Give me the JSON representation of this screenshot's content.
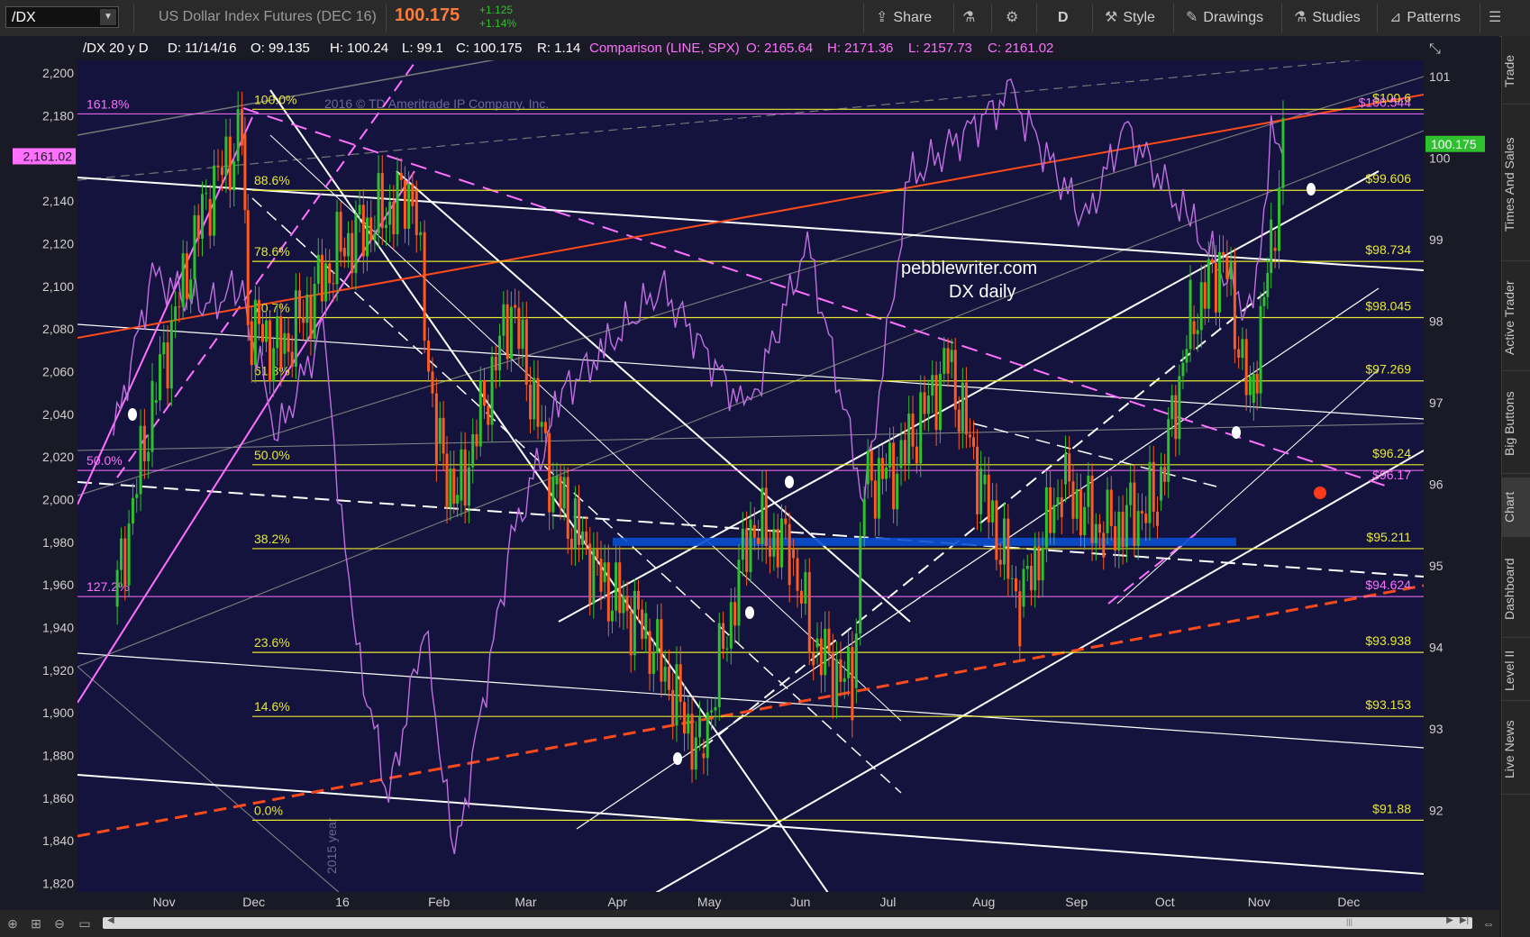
{
  "toolbar": {
    "symbol": "/DX",
    "description": "US Dollar Index Futures (DEC 16)",
    "last_price": "100.175",
    "change_abs": "+1.125",
    "change_pct": "+1.14%",
    "buttons": {
      "share": "Share",
      "timeframe": "D",
      "style": "Style",
      "drawings": "Drawings",
      "studies": "Studies",
      "patterns": "Patterns"
    }
  },
  "sidebar": {
    "tabs": [
      "Trade",
      "Times And Sales",
      "Active Trader",
      "Big Buttons",
      "Chart",
      "Dashboard",
      "Level II",
      "Live News"
    ],
    "active": "Chart"
  },
  "header": {
    "symbol": "/DX 20 y D",
    "date": "D: 11/14/16",
    "open": "O: 99.135",
    "high": "H: 100.24",
    "low": "L: 99.1",
    "close": "C: 100.175",
    "range": "R: 1.14",
    "comparison": "Comparison (LINE, SPX)",
    "cmp_open": "O: 2165.64",
    "cmp_high": "H: 2171.36",
    "cmp_low": "L: 2157.73",
    "cmp_close": "C: 2161.02"
  },
  "watermark": "2016 © TD Ameritrade IP Company, Inc.",
  "year_marker": "2015 year",
  "annotation": {
    "line1": "pebblewriter.com",
    "line2": "DX daily"
  },
  "colors": {
    "background": "#13133e",
    "up_candle": "#2ec02e",
    "down_candle": "#ff5a1e",
    "comparison_line": "#c070e0",
    "fib_line": "#e8e830",
    "magenta_line": "#ff70ff",
    "red_line": "#ff4a1a",
    "zone_blue": "#0a4fd0"
  },
  "chart_data": {
    "type": "candlestick",
    "x_labels": [
      "Nov",
      "Dec",
      "16",
      "Feb",
      "Mar",
      "Apr",
      "May",
      "Jun",
      "Jul",
      "Aug",
      "Sep",
      "Oct",
      "Nov",
      "Dec"
    ],
    "left_axis": {
      "label": "SPX",
      "ticks": [
        "2,200",
        "2,180",
        "2,160",
        "2,140",
        "2,120",
        "2,100",
        "2,080",
        "2,060",
        "2,040",
        "2,020",
        "2,000",
        "1,980",
        "1,960",
        "1,940",
        "1,920",
        "1,900",
        "1,880",
        "1,860",
        "1,840",
        "1,820"
      ],
      "range": [
        1816,
        2206
      ],
      "current_tag": "2,161.02"
    },
    "right_axis": {
      "label": "DX",
      "ticks": [
        "101",
        "100",
        "99",
        "98",
        "97",
        "96",
        "95",
        "94",
        "93",
        "92"
      ],
      "range": [
        91.0,
        101.2
      ],
      "current_tag": "100.175"
    },
    "fib_levels": [
      {
        "pct": "100.0%",
        "value": "$100.6",
        "dx": 100.6
      },
      {
        "pct": "88.6%",
        "value": "$99.606",
        "dx": 99.606
      },
      {
        "pct": "78.6%",
        "value": "$98.734",
        "dx": 98.734
      },
      {
        "pct": "70.7%",
        "value": "$98.045",
        "dx": 98.045
      },
      {
        "pct": "61.8%",
        "value": "$97.269",
        "dx": 97.269
      },
      {
        "pct": "50.0%",
        "value": "$96.24",
        "dx": 96.24
      },
      {
        "pct": "38.2%",
        "value": "$95.211",
        "dx": 95.211
      },
      {
        "pct": "23.6%",
        "value": "$93.938",
        "dx": 93.938
      },
      {
        "pct": "14.6%",
        "value": "$93.153",
        "dx": 93.153
      },
      {
        "pct": "0.0%",
        "value": "$91.88",
        "dx": 91.88
      }
    ],
    "magenta_levels": [
      {
        "pct": "161.8%",
        "value": "$100.544",
        "dx": 100.544
      },
      {
        "pct": "50.0%",
        "value": "$96.17",
        "dx": 96.17
      },
      {
        "pct": "127.2%",
        "value": "$94.624",
        "dx": 94.624
      }
    ],
    "dx_path": [
      [
        "2015-10-20",
        94.5
      ],
      [
        "2015-11-02",
        97.0
      ],
      [
        "2015-11-20",
        99.5
      ],
      [
        "2015-12-02",
        100.3
      ],
      [
        "2015-12-04",
        98.0
      ],
      [
        "2015-12-15",
        97.6
      ],
      [
        "2016-01-04",
        98.9
      ],
      [
        "2016-01-28",
        99.6
      ],
      [
        "2016-02-05",
        96.5
      ],
      [
        "2016-02-12",
        95.8
      ],
      [
        "2016-03-01",
        98.2
      ],
      [
        "2016-03-15",
        96.0
      ],
      [
        "2016-03-31",
        94.8
      ],
      [
        "2016-04-15",
        94.2
      ],
      [
        "2016-05-03",
        92.7
      ],
      [
        "2016-05-20",
        95.5
      ],
      [
        "2016-06-02",
        95.2
      ],
      [
        "2016-06-10",
        94.0
      ],
      [
        "2016-06-23",
        93.5
      ],
      [
        "2016-06-27",
        96.0
      ],
      [
        "2016-07-08",
        96.2
      ],
      [
        "2016-07-25",
        97.5
      ],
      [
        "2016-08-05",
        96.0
      ],
      [
        "2016-08-18",
        94.5
      ],
      [
        "2016-09-01",
        96.0
      ],
      [
        "2016-09-15",
        95.4
      ],
      [
        "2016-10-03",
        95.8
      ],
      [
        "2016-10-14",
        98.0
      ],
      [
        "2016-10-25",
        98.8
      ],
      [
        "2016-11-03",
        97.0
      ],
      [
        "2016-11-10",
        98.9
      ],
      [
        "2016-11-14",
        100.175
      ]
    ],
    "spx_path": [
      [
        "2015-10-20",
        2030
      ],
      [
        "2015-11-02",
        2105
      ],
      [
        "2015-11-20",
        2090
      ],
      [
        "2015-12-01",
        2100
      ],
      [
        "2015-12-14",
        2030
      ],
      [
        "2015-12-29",
        2080
      ],
      [
        "2016-01-08",
        1940
      ],
      [
        "2016-01-20",
        1860
      ],
      [
        "2016-02-01",
        1940
      ],
      [
        "2016-02-11",
        1830
      ],
      [
        "2016-03-01",
        1980
      ],
      [
        "2016-03-18",
        2050
      ],
      [
        "2016-04-01",
        2070
      ],
      [
        "2016-04-20",
        2100
      ],
      [
        "2016-05-19",
        2040
      ],
      [
        "2016-06-08",
        2120
      ],
      [
        "2016-06-27",
        2000
      ],
      [
        "2016-07-12",
        2150
      ],
      [
        "2016-08-15",
        2190
      ],
      [
        "2016-09-09",
        2130
      ],
      [
        "2016-09-22",
        2175
      ],
      [
        "2016-10-14",
        2130
      ],
      [
        "2016-11-04",
        2085
      ],
      [
        "2016-11-10",
        2170
      ],
      [
        "2016-11-14",
        2161
      ]
    ]
  }
}
